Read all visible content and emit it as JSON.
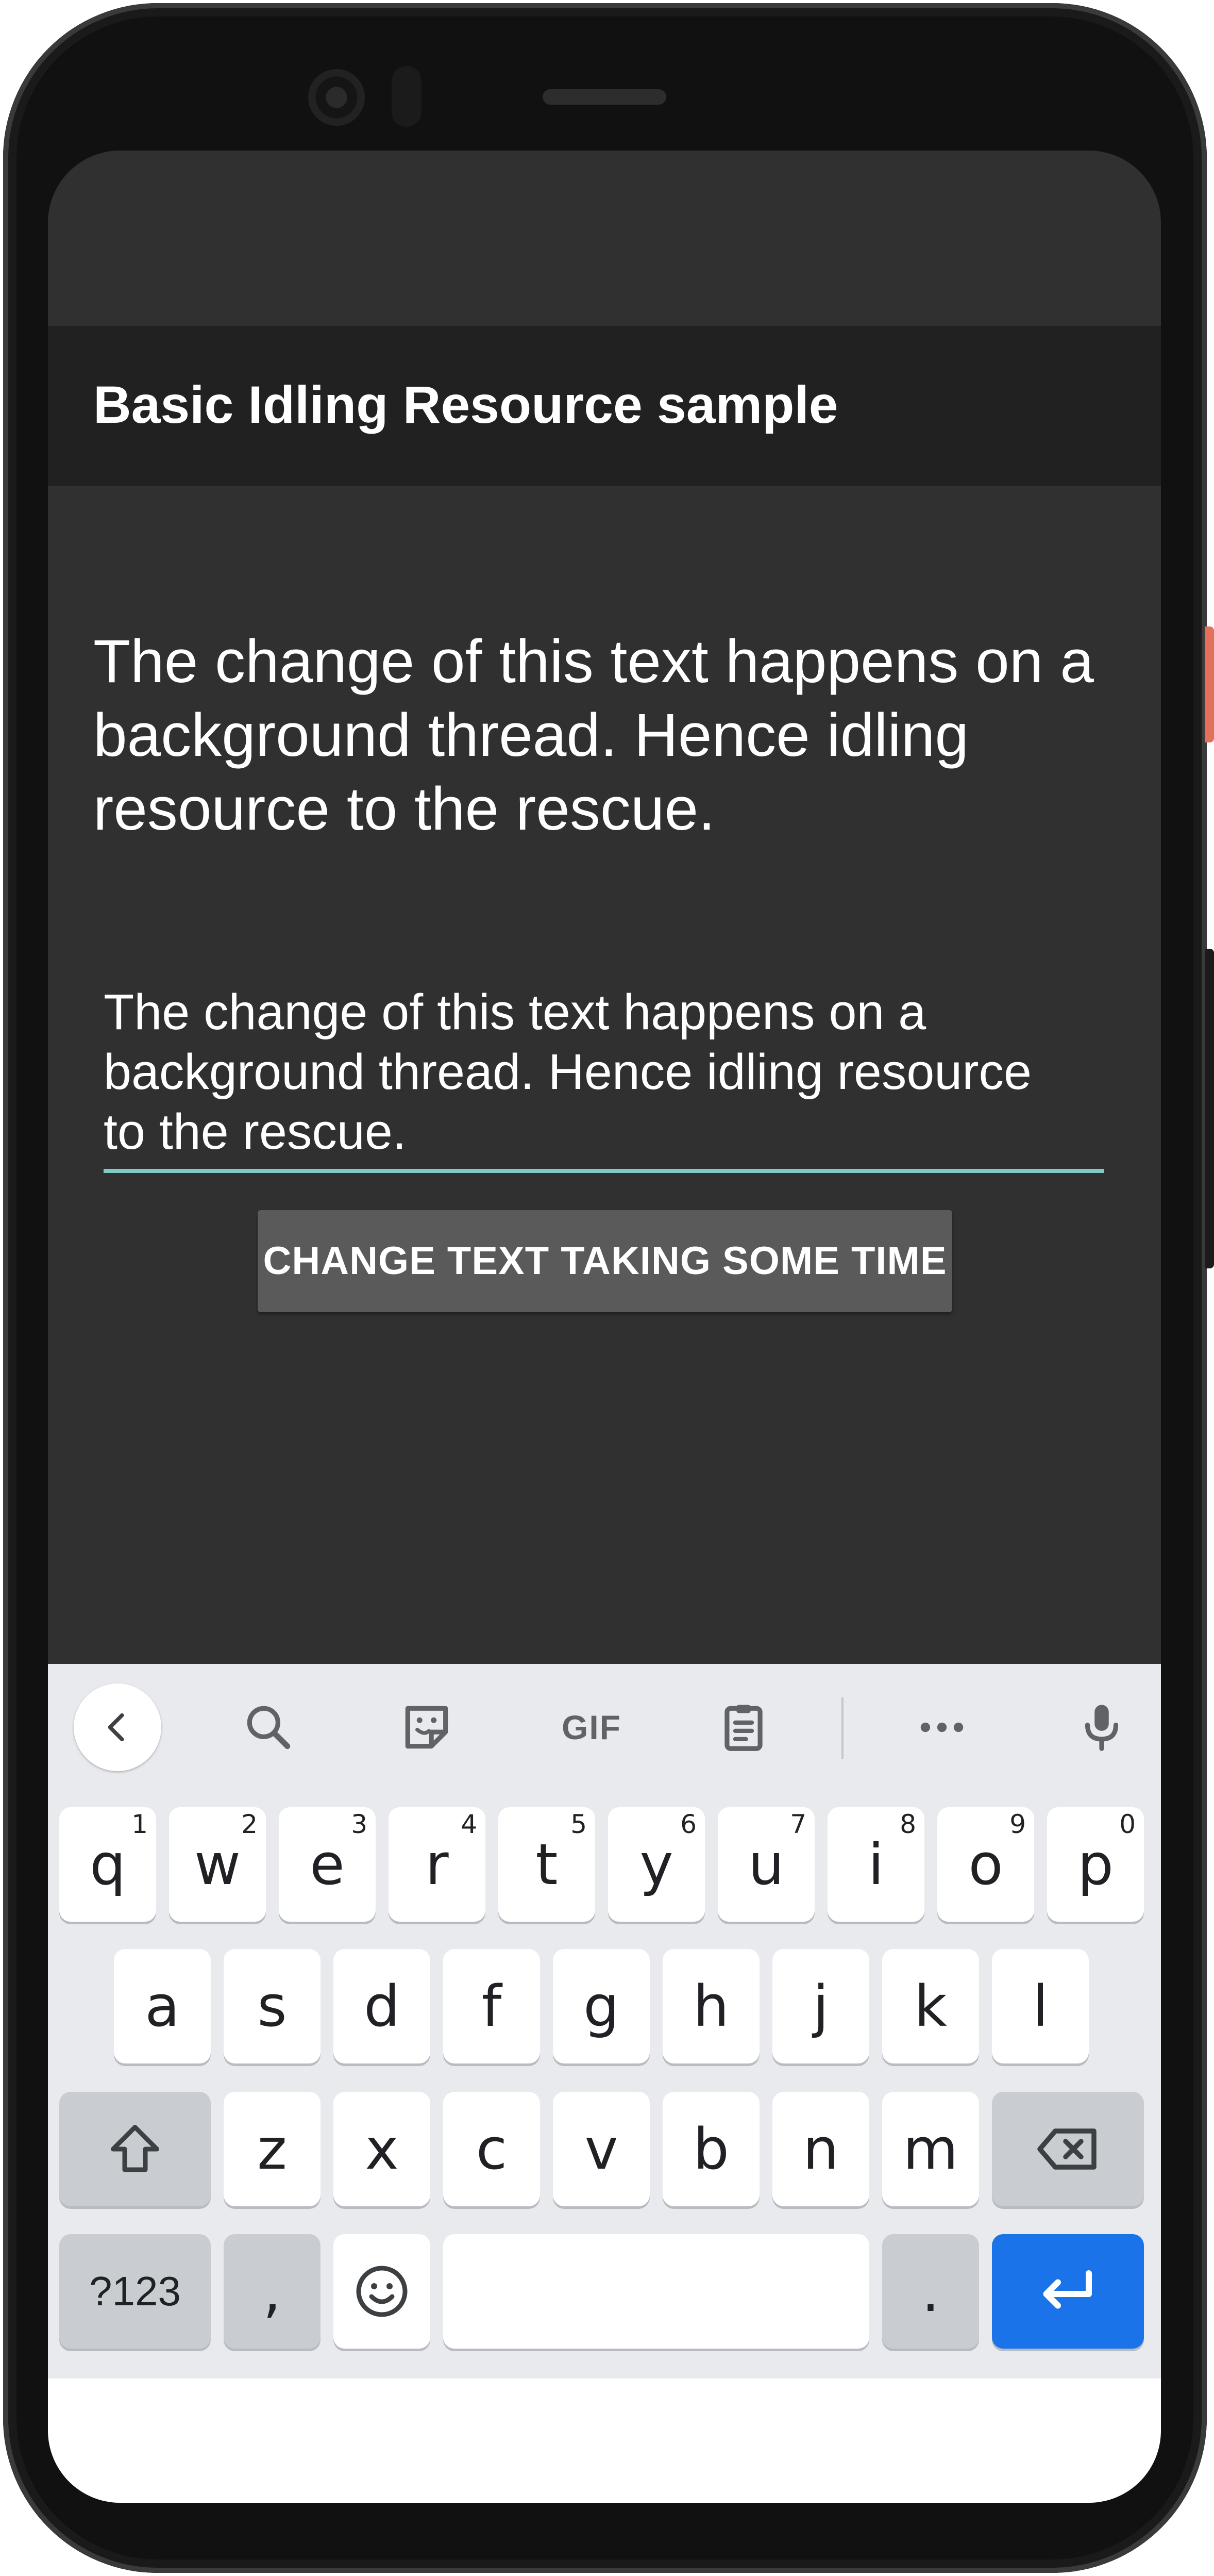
{
  "app": {
    "title": "Basic Idling Resource sample"
  },
  "main": {
    "description": "The change of this text happens on a background thread. Hence idling resource to the rescue.",
    "edit_text_value": "The change of this text happens on a\nbackground thread. Hence idling resource\nto the rescue.",
    "button_label": "CHANGE TEXT TAKING SOME TIME",
    "accent_color": "#80cbc4"
  },
  "keyboard": {
    "toolbar": {
      "icons": [
        "chevron-left-icon",
        "search-icon",
        "sticker-icon",
        "gif-icon",
        "clipboard-icon",
        "more-icon",
        "microphone-icon"
      ],
      "gif_label": "GIF"
    },
    "row1": [
      {
        "key": "q",
        "hint": "1"
      },
      {
        "key": "w",
        "hint": "2"
      },
      {
        "key": "e",
        "hint": "3"
      },
      {
        "key": "r",
        "hint": "4"
      },
      {
        "key": "t",
        "hint": "5"
      },
      {
        "key": "y",
        "hint": "6"
      },
      {
        "key": "u",
        "hint": "7"
      },
      {
        "key": "i",
        "hint": "8"
      },
      {
        "key": "o",
        "hint": "9"
      },
      {
        "key": "p",
        "hint": "0"
      }
    ],
    "row2": [
      "a",
      "s",
      "d",
      "f",
      "g",
      "h",
      "j",
      "k",
      "l"
    ],
    "row3": [
      "z",
      "x",
      "c",
      "v",
      "b",
      "n",
      "m"
    ],
    "row4": {
      "symbols": "?123",
      "comma": ",",
      "period": "."
    },
    "enter_color": "#1a73e8"
  }
}
